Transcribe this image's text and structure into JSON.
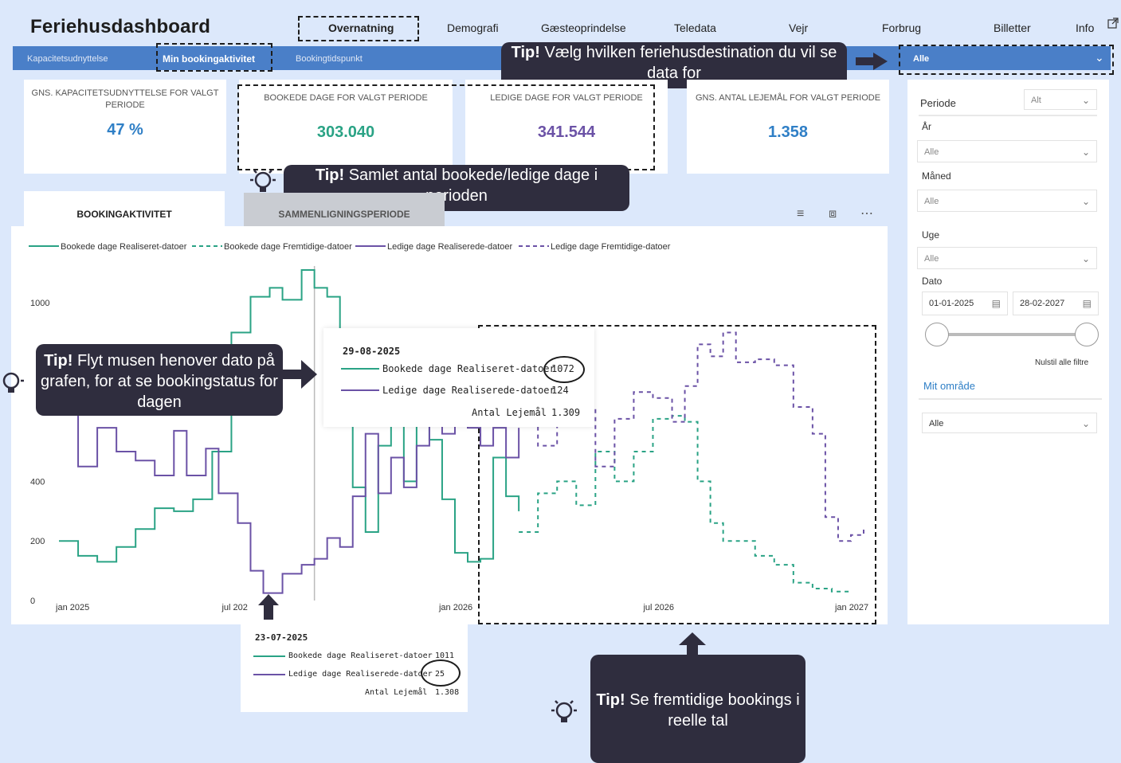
{
  "app": {
    "title": "Feriehusdashboard"
  },
  "nav": {
    "items": [
      "Overnatning",
      "Demografi",
      "Gæsteoprindelse",
      "Teledata",
      "Vejr",
      "Forbrug",
      "Billetter",
      "Info"
    ]
  },
  "subtabs": [
    "Kapacitetsudnyttelse",
    "Min bookingaktivitet",
    "Bookingtidspunkt"
  ],
  "destination": {
    "value": "Alle"
  },
  "kpis": [
    {
      "label": "GNS. KAPACITETSUDNYTTELSE FOR VALGT PERIODE",
      "value": "47 %",
      "color": "#2f7fc6"
    },
    {
      "label": "BOOKEDE DAGE FOR VALGT PERIODE",
      "value": "303.040",
      "color": "#2aa385"
    },
    {
      "label": "LEDIGE DAGE FOR VALGT PERIODE",
      "value": "341.544",
      "color": "#6b52a6"
    },
    {
      "label": "GNS. ANTAL LEJEMÅL FOR VALGT PERIODE",
      "value": "1.358",
      "color": "#2f7fc6"
    }
  ],
  "tabs": {
    "active": "BOOKINGAKTIVITET",
    "other": "SAMMENLIGNINGSPERIODE"
  },
  "filters": {
    "periode_label": "Periode",
    "periode_value": "Alt",
    "aar_label": "År",
    "aar_value": "Alle",
    "maaned_label": "Måned",
    "maaned_value": "Alle",
    "uge_label": "Uge",
    "uge_value": "Alle",
    "dato_label": "Dato",
    "date_from": "01-01-2025",
    "date_to": "28-02-2027",
    "reset": "Nulstil alle filtre",
    "omraade_label": "Mit område",
    "omraade_value": "Alle"
  },
  "tooltip_main": {
    "date": "29-08-2025",
    "rows": [
      {
        "label": "Bookede dage Realiseret-datoer",
        "value": "1072",
        "color": "#2aa385"
      },
      {
        "label": "Ledige dage Realiserede-datoer",
        "value": "124",
        "color": "#6b52a6"
      }
    ],
    "extra_label": "Antal Lejemål",
    "extra_value": "1.309"
  },
  "tooltip_low": {
    "date": "23-07-2025",
    "rows": [
      {
        "label": "Bookede dage Realiseret-datoer",
        "value": "1011",
        "color": "#2aa385"
      },
      {
        "label": "Ledige dage Realiserede-datoer",
        "value": "25",
        "color": "#6b52a6"
      }
    ],
    "extra_label": "Antal Lejemål",
    "extra_value": "1.308"
  },
  "tips": {
    "destination": {
      "bold": "Tip!",
      "text": " Vælg hvilken feriehusdestination du vil se data for"
    },
    "kpi": {
      "bold": "Tip!",
      "text": " Samlet antal bookede/ledige dage i perioden"
    },
    "hover": {
      "bold": "Tip!",
      "text": " Flyt musen henover dato på grafen, for at se bookingstatus for dagen"
    },
    "future": {
      "bold": "Tip!",
      "text": " Se fremtidige bookings i reelle tal"
    }
  },
  "chart_data": {
    "type": "line",
    "xlabel": "",
    "ylabel": "",
    "ylim": [
      0,
      1150
    ],
    "yticks": [
      0,
      200,
      400,
      1000
    ],
    "xticks": [
      "jan 2025",
      "jul 202",
      "jan 2026",
      "jul 2026",
      "jan 2027"
    ],
    "legend_position": "top-left",
    "series": [
      {
        "name": "Bookede dage Realiseret-datoer",
        "color": "#2aa385",
        "dash": false,
        "values": [
          [
            0,
            200
          ],
          [
            3,
            150
          ],
          [
            6,
            130
          ],
          [
            9,
            180
          ],
          [
            12,
            240
          ],
          [
            15,
            310
          ],
          [
            18,
            300
          ],
          [
            21,
            340
          ],
          [
            24,
            500
          ],
          [
            27,
            900
          ],
          [
            30,
            1020
          ],
          [
            33,
            1050
          ],
          [
            35,
            1010
          ],
          [
            38,
            1110
          ],
          [
            40,
            1050
          ],
          [
            42,
            1020
          ],
          [
            44,
            700
          ],
          [
            46,
            380
          ],
          [
            48,
            230
          ],
          [
            50,
            520
          ],
          [
            52,
            600
          ],
          [
            54,
            400
          ],
          [
            56,
            640
          ],
          [
            58,
            540
          ],
          [
            60,
            340
          ],
          [
            62,
            160
          ],
          [
            64,
            130
          ],
          [
            66,
            140
          ],
          [
            68,
            480
          ],
          [
            70,
            350
          ],
          [
            72,
            300
          ]
        ]
      },
      {
        "name": "Bookede dage Fremtidige-datoer",
        "color": "#2aa385",
        "dash": true,
        "values": [
          [
            72,
            230
          ],
          [
            75,
            360
          ],
          [
            78,
            400
          ],
          [
            81,
            320
          ],
          [
            84,
            500
          ],
          [
            87,
            400
          ],
          [
            90,
            500
          ],
          [
            93,
            610
          ],
          [
            96,
            620
          ],
          [
            98,
            600
          ],
          [
            100,
            400
          ],
          [
            102,
            260
          ],
          [
            104,
            200
          ],
          [
            106,
            200
          ],
          [
            109,
            150
          ],
          [
            112,
            120
          ],
          [
            115,
            60
          ],
          [
            118,
            40
          ],
          [
            121,
            30
          ],
          [
            124,
            30
          ]
        ]
      },
      {
        "name": "Ledige dage Realiserede-datoer",
        "color": "#6b52a6",
        "dash": false,
        "values": [
          [
            0,
            660
          ],
          [
            3,
            450
          ],
          [
            6,
            580
          ],
          [
            9,
            500
          ],
          [
            12,
            470
          ],
          [
            15,
            420
          ],
          [
            18,
            570
          ],
          [
            20,
            420
          ],
          [
            23,
            510
          ],
          [
            25,
            360
          ],
          [
            28,
            260
          ],
          [
            30,
            100
          ],
          [
            32,
            25
          ],
          [
            35,
            90
          ],
          [
            38,
            120
          ],
          [
            40,
            140
          ],
          [
            42,
            210
          ],
          [
            44,
            180
          ],
          [
            46,
            350
          ],
          [
            48,
            560
          ],
          [
            50,
            360
          ],
          [
            52,
            480
          ],
          [
            54,
            380
          ],
          [
            56,
            520
          ],
          [
            58,
            600
          ],
          [
            60,
            560
          ],
          [
            62,
            620
          ],
          [
            64,
            580
          ],
          [
            66,
            520
          ],
          [
            68,
            580
          ],
          [
            70,
            480
          ],
          [
            72,
            580
          ]
        ]
      },
      {
        "name": "Ledige dage Fremtidige-datoer",
        "color": "#6b52a6",
        "dash": true,
        "values": [
          [
            72,
            600
          ],
          [
            75,
            520
          ],
          [
            78,
            680
          ],
          [
            81,
            650
          ],
          [
            84,
            450
          ],
          [
            87,
            610
          ],
          [
            90,
            700
          ],
          [
            93,
            680
          ],
          [
            96,
            600
          ],
          [
            98,
            720
          ],
          [
            100,
            860
          ],
          [
            102,
            820
          ],
          [
            104,
            900
          ],
          [
            106,
            800
          ],
          [
            109,
            810
          ],
          [
            112,
            790
          ],
          [
            115,
            650
          ],
          [
            118,
            560
          ],
          [
            120,
            280
          ],
          [
            122,
            200
          ],
          [
            124,
            220
          ],
          [
            126,
            240
          ]
        ]
      }
    ]
  }
}
